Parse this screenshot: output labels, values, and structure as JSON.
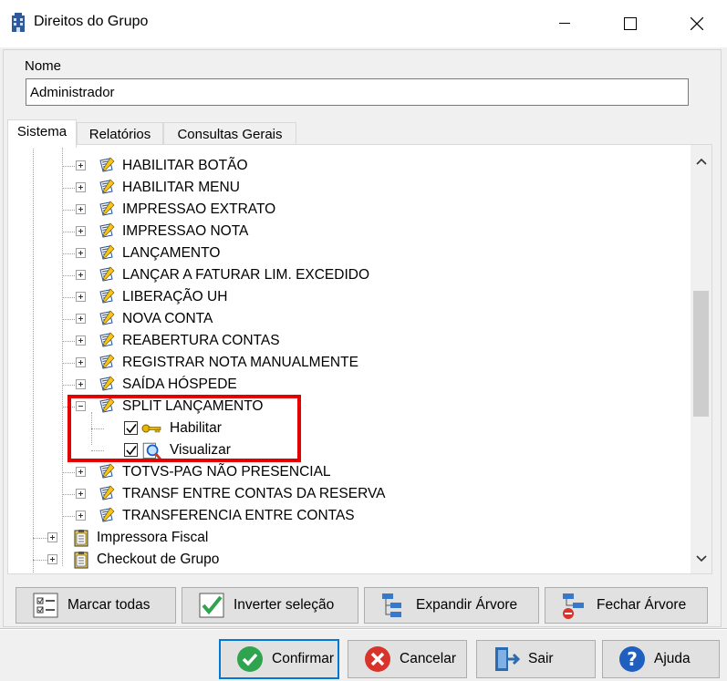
{
  "window": {
    "title": "Direitos do Grupo",
    "icon": "building-icon",
    "controls": [
      "minimize-icon",
      "maximize-icon",
      "close-icon"
    ]
  },
  "name_field": {
    "label": "Nome",
    "value": "Administrador"
  },
  "tabs": [
    {
      "label": "Sistema",
      "active": true
    },
    {
      "label": "Relatórios",
      "active": false
    },
    {
      "label": "Consultas Gerais",
      "active": false
    }
  ],
  "tree": {
    "items": [
      {
        "label": "HABILITAR BOTÃO",
        "icon": "document-pencil-icon",
        "expanded": false
      },
      {
        "label": "HABILITAR MENU",
        "icon": "document-pencil-icon",
        "expanded": false
      },
      {
        "label": "IMPRESSAO EXTRATO",
        "icon": "document-pencil-icon",
        "expanded": false
      },
      {
        "label": "IMPRESSAO NOTA",
        "icon": "document-pencil-icon",
        "expanded": false
      },
      {
        "label": "LANÇAMENTO",
        "icon": "document-pencil-icon",
        "expanded": false
      },
      {
        "label": "LANÇAR A FATURAR LIM. EXCEDIDO",
        "icon": "document-pencil-icon",
        "expanded": false
      },
      {
        "label": "LIBERAÇÃO UH",
        "icon": "document-pencil-icon",
        "expanded": false
      },
      {
        "label": "NOVA CONTA",
        "icon": "document-pencil-icon",
        "expanded": false
      },
      {
        "label": "REABERTURA CONTAS",
        "icon": "document-pencil-icon",
        "expanded": false
      },
      {
        "label": "REGISTRAR NOTA MANUALMENTE",
        "icon": "document-pencil-icon",
        "expanded": false
      },
      {
        "label": "SAÍDA HÓSPEDE",
        "icon": "document-pencil-icon",
        "expanded": false
      },
      {
        "label": "SPLIT LANÇAMENTO",
        "icon": "document-pencil-icon",
        "expanded": true,
        "children": [
          {
            "label": "Habilitar",
            "icon": "key-icon",
            "checked": true
          },
          {
            "label": "Visualizar",
            "icon": "magnifier-icon",
            "checked": true
          }
        ]
      },
      {
        "label": "TOTVS-PAG NÃO PRESENCIAL",
        "icon": "document-pencil-icon",
        "expanded": false
      },
      {
        "label": "TRANSF ENTRE CONTAS DA RESERVA",
        "icon": "document-pencil-icon",
        "expanded": false
      },
      {
        "label": "TRANSFERENCIA ENTRE CONTAS",
        "icon": "document-pencil-icon",
        "expanded": false
      }
    ],
    "top_level": [
      {
        "label": "Impressora Fiscal",
        "icon": "clipboard-icon",
        "expanded": false
      },
      {
        "label": "Checkout de Grupo",
        "icon": "clipboard-icon",
        "expanded": false
      }
    ],
    "highlight_color": "#e50000"
  },
  "tree_buttons": [
    {
      "label": "Marcar todas",
      "icon": "checklist-icon"
    },
    {
      "label": "Inverter seleção",
      "icon": "checkmark-icon"
    },
    {
      "label": "Expandir Árvore",
      "icon": "tree-expand-icon"
    },
    {
      "label": "Fechar Árvore",
      "icon": "tree-collapse-icon"
    }
  ],
  "footer_buttons": [
    {
      "label": "Confirmar",
      "icon": "confirm-check-icon",
      "color": "#2ea44f"
    },
    {
      "label": "Cancelar",
      "icon": "cancel-x-icon",
      "color": "#d9342b"
    },
    {
      "label": "Sair",
      "icon": "exit-door-icon",
      "color": "#2b6cb0"
    },
    {
      "label": "Ajuda",
      "icon": "help-question-icon",
      "color": "#1f5fbf"
    }
  ]
}
